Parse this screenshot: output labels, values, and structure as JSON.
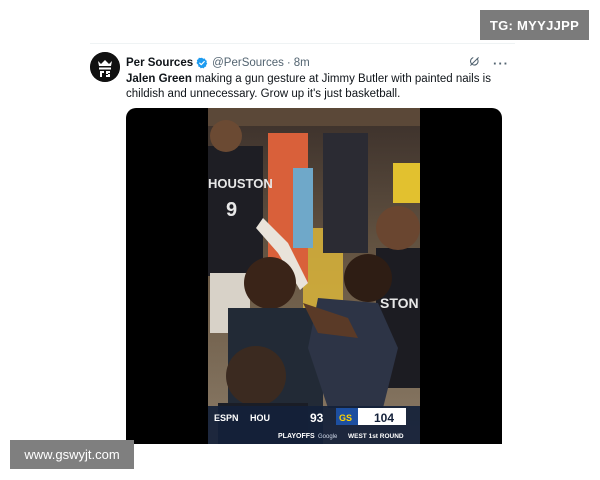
{
  "badge": {
    "text": "TG: MYYJJPP"
  },
  "tweet": {
    "author_name": "Per Sources",
    "handle": "@PerSources",
    "separator": "·",
    "time": "8m",
    "more": "···",
    "text_bold": "Jalen Green",
    "text_rest": " making a gun gesture at Jimmy Butler with painted nails is childish and unnecessary. Grow up it's just basketball."
  },
  "video": {
    "jersey_text": "HOUSTON",
    "jersey_number": "9",
    "jersey_text_right": "STON",
    "score": {
      "network": "ESPN",
      "home_team": "HOU",
      "home_score": "93",
      "away_team": "GS",
      "away_score": "104",
      "event": "PLAYOFFS",
      "round": "WEST 1st ROUND",
      "sponsor": "Google"
    }
  },
  "watermark": {
    "text": "www.gswyjt.com"
  },
  "colors": {
    "verified": "#1d9bf0",
    "handle": "#536471",
    "media_bg": "#000000"
  }
}
